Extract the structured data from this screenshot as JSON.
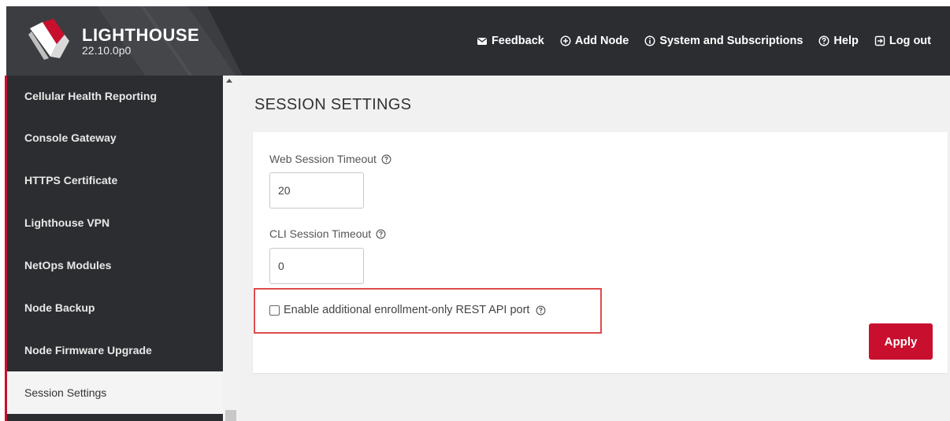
{
  "app": {
    "name": "LIGHTHOUSE",
    "version": "22.10.0p0"
  },
  "topnav": [
    {
      "label": "Feedback",
      "icon": "envelope-icon"
    },
    {
      "label": "Add Node",
      "icon": "plus-circle-icon"
    },
    {
      "label": "System and Subscriptions",
      "icon": "info-circle-icon"
    },
    {
      "label": "Help",
      "icon": "question-circle-icon"
    },
    {
      "label": "Log out",
      "icon": "logout-icon"
    }
  ],
  "sidebar": {
    "items": [
      {
        "label": "Cellular Health Reporting"
      },
      {
        "label": "Console Gateway"
      },
      {
        "label": "HTTPS Certificate"
      },
      {
        "label": "Lighthouse VPN"
      },
      {
        "label": "NetOps Modules"
      },
      {
        "label": "Node Backup"
      },
      {
        "label": "Node Firmware Upgrade"
      },
      {
        "label": "Session Settings",
        "active": true
      }
    ]
  },
  "main": {
    "title": "SESSION SETTINGS",
    "web_timeout": {
      "label": "Web Session Timeout",
      "value": "20"
    },
    "cli_timeout": {
      "label": "CLI Session Timeout",
      "value": "0"
    },
    "enrollment_port": {
      "label": "Enable additional enrollment-only REST API port",
      "checked": false
    },
    "apply_label": "Apply"
  },
  "colors": {
    "accent": "#c8102e",
    "header_bg": "#2b2d30",
    "highlight_box": "#e04b4b"
  }
}
